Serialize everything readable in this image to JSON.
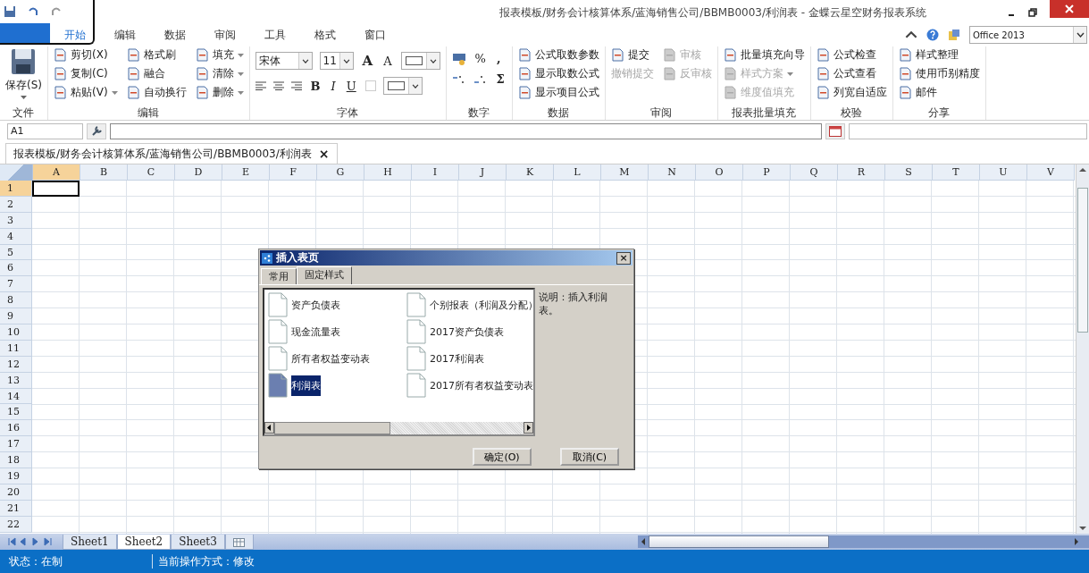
{
  "window": {
    "title": "报表模板/财务会计核算体系/蓝海销售公司/BBMB0003/利润表 - 金蝶云星空财务报表系统"
  },
  "ribbon_tabs": [
    {
      "label": "开始",
      "selected": true
    },
    {
      "label": "编辑",
      "selected": false
    },
    {
      "label": "数据",
      "selected": false
    },
    {
      "label": "审阅",
      "selected": false
    },
    {
      "label": "工具",
      "selected": false
    },
    {
      "label": "格式",
      "selected": false
    },
    {
      "label": "窗口",
      "selected": false
    }
  ],
  "theme_select": {
    "value": "Office 2013"
  },
  "ribbon_groups": [
    {
      "kind": "tools",
      "label": "文件",
      "columns": [
        [
          {
            "label": "保存(S)",
            "kind": "large",
            "disabled": false,
            "dropdown": true
          }
        ]
      ]
    },
    {
      "kind": "tools",
      "label": "编辑",
      "columns": [
        [
          {
            "label": "剪切(X)",
            "kind": "small",
            "disabled": false,
            "dropdown": false
          },
          {
            "label": "复制(C)",
            "kind": "small",
            "disabled": false,
            "dropdown": false
          },
          {
            "label": "粘贴(V)",
            "kind": "small",
            "disabled": false,
            "dropdown": true
          }
        ],
        [
          {
            "label": "格式刷",
            "kind": "small",
            "disabled": false,
            "dropdown": false
          },
          {
            "label": "融合",
            "kind": "small",
            "disabled": false,
            "dropdown": false
          },
          {
            "label": "自动换行",
            "kind": "small",
            "disabled": false,
            "dropdown": false
          }
        ],
        [
          {
            "label": "填充",
            "kind": "small",
            "disabled": false,
            "dropdown": true
          },
          {
            "label": "清除",
            "kind": "small",
            "disabled": false,
            "dropdown": true
          },
          {
            "label": "删除",
            "kind": "small",
            "disabled": false,
            "dropdown": true
          }
        ]
      ]
    },
    {
      "kind": "font",
      "label": "字体",
      "font": "宋体",
      "size": "11",
      "grow": "A",
      "shrink": "A",
      "bold": "B",
      "italic": "I",
      "underline": "U"
    },
    {
      "kind": "number",
      "label": "数字",
      "percent": "%",
      "comma": ",",
      "sum": "Σ"
    },
    {
      "kind": "tools",
      "label": "数据",
      "columns": [
        [
          {
            "label": "公式取数参数",
            "kind": "small",
            "disabled": false,
            "dropdown": false
          },
          {
            "label": "显示取数公式",
            "kind": "small",
            "disabled": false,
            "dropdown": false
          },
          {
            "label": "显示项目公式",
            "kind": "small",
            "disabled": false,
            "dropdown": false
          }
        ]
      ]
    },
    {
      "kind": "tools",
      "label": "审阅",
      "columns": [
        [
          {
            "label": "提交",
            "kind": "small",
            "disabled": false,
            "dropdown": false
          },
          {
            "label": "撤销提交",
            "kind": "text",
            "disabled": true,
            "dropdown": false
          }
        ],
        [
          {
            "label": "审核",
            "kind": "small",
            "disabled": true,
            "dropdown": false
          },
          {
            "label": "反审核",
            "kind": "small",
            "disabled": true,
            "dropdown": false
          }
        ]
      ]
    },
    {
      "kind": "tools",
      "label": "报表批量填充",
      "columns": [
        [
          {
            "label": "批量填充向导",
            "kind": "small",
            "disabled": false,
            "dropdown": false
          },
          {
            "label": "样式方案",
            "kind": "small",
            "disabled": true,
            "dropdown": true
          },
          {
            "label": "维度值填充",
            "kind": "small",
            "disabled": true,
            "dropdown": false
          }
        ]
      ]
    },
    {
      "kind": "tools",
      "label": "校验",
      "columns": [
        [
          {
            "label": "公式检查",
            "kind": "small",
            "disabled": false,
            "dropdown": false
          },
          {
            "label": "公式查看",
            "kind": "small",
            "disabled": false,
            "dropdown": false
          },
          {
            "label": "列宽自适应",
            "kind": "small",
            "disabled": false,
            "dropdown": false
          }
        ]
      ]
    },
    {
      "kind": "tools",
      "label": "分享",
      "columns": [
        [
          {
            "label": "样式整理",
            "kind": "small",
            "disabled": false,
            "dropdown": false
          },
          {
            "label": "使用币别精度",
            "kind": "small",
            "disabled": false,
            "dropdown": false
          },
          {
            "label": "邮件",
            "kind": "small",
            "disabled": false,
            "dropdown": false
          }
        ]
      ]
    }
  ],
  "formula_bar": {
    "name_box": "A1"
  },
  "document_tab": {
    "label": "报表模板/财务会计核算体系/蓝海销售公司/BBMB0003/利润表",
    "close": "×"
  },
  "grid": {
    "columns": [
      {
        "label": "A",
        "selected": true
      },
      {
        "label": "B",
        "selected": false
      },
      {
        "label": "C",
        "selected": false
      },
      {
        "label": "D",
        "selected": false
      },
      {
        "label": "E",
        "selected": false
      },
      {
        "label": "F",
        "selected": false
      },
      {
        "label": "G",
        "selected": false
      },
      {
        "label": "H",
        "selected": false
      },
      {
        "label": "I",
        "selected": false
      },
      {
        "label": "J",
        "selected": false
      },
      {
        "label": "K",
        "selected": false
      },
      {
        "label": "L",
        "selected": false
      },
      {
        "label": "M",
        "selected": false
      },
      {
        "label": "N",
        "selected": false
      },
      {
        "label": "O",
        "selected": false
      },
      {
        "label": "P",
        "selected": false
      },
      {
        "label": "Q",
        "selected": false
      },
      {
        "label": "R",
        "selected": false
      },
      {
        "label": "S",
        "selected": false
      },
      {
        "label": "T",
        "selected": false
      },
      {
        "label": "U",
        "selected": false
      },
      {
        "label": "V",
        "selected": false
      }
    ],
    "rows": [
      {
        "label": "1",
        "selected": true
      },
      {
        "label": "2",
        "selected": false
      },
      {
        "label": "3",
        "selected": false
      },
      {
        "label": "4",
        "selected": false
      },
      {
        "label": "5",
        "selected": false
      },
      {
        "label": "6",
        "selected": false
      },
      {
        "label": "7",
        "selected": false
      },
      {
        "label": "8",
        "selected": false
      },
      {
        "label": "9",
        "selected": false
      },
      {
        "label": "10",
        "selected": false
      },
      {
        "label": "11",
        "selected": false
      },
      {
        "label": "12",
        "selected": false
      },
      {
        "label": "13",
        "selected": false
      },
      {
        "label": "14",
        "selected": false
      },
      {
        "label": "15",
        "selected": false
      },
      {
        "label": "16",
        "selected": false
      },
      {
        "label": "17",
        "selected": false
      },
      {
        "label": "18",
        "selected": false
      },
      {
        "label": "19",
        "selected": false
      },
      {
        "label": "20",
        "selected": false
      },
      {
        "label": "21",
        "selected": false
      },
      {
        "label": "22",
        "selected": false
      }
    ]
  },
  "dialog": {
    "title": "插入表页",
    "close": "×",
    "tabs": [
      {
        "label": "常用",
        "selected": false
      },
      {
        "label": "固定样式",
        "selected": true
      }
    ],
    "items": [
      {
        "label": "资产负债表",
        "selected": false
      },
      {
        "label": "个别报表（利润及分配）",
        "selected": false
      },
      {
        "label": "现金流量表",
        "selected": false
      },
      {
        "label": "2017资产负债表",
        "selected": false
      },
      {
        "label": "所有者权益变动表",
        "selected": false
      },
      {
        "label": "2017利润表",
        "selected": false
      },
      {
        "label": "利润表",
        "selected": true
      },
      {
        "label": "2017所有者权益变动表",
        "selected": false
      }
    ],
    "description": "说明：插入利润表。",
    "buttons": [
      "确定(O)",
      "取消(C)"
    ]
  },
  "sheet_tabs": [
    {
      "label": "Sheet1",
      "selected": false
    },
    {
      "label": "Sheet2",
      "selected": true
    },
    {
      "label": "Sheet3",
      "selected": false
    }
  ],
  "status_bar": [
    "状态：在制",
    "当前操作方式：修改"
  ]
}
